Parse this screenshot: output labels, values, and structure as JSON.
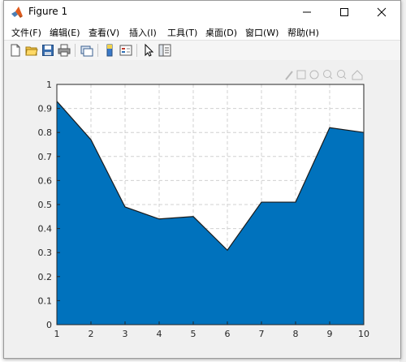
{
  "window": {
    "title": "Figure 1",
    "controls": {
      "minimize": "—",
      "maximize": "☐",
      "close": "✕"
    }
  },
  "menu": [
    {
      "label": "文件(F)"
    },
    {
      "label": "编辑(E)"
    },
    {
      "label": "查看(V)"
    },
    {
      "label": "插入(I)"
    },
    {
      "label": "工具(T)"
    },
    {
      "label": "桌面(D)"
    },
    {
      "label": "窗口(W)"
    },
    {
      "label": "帮助(H)"
    }
  ],
  "toolbar_icons": [
    "new-figure-icon",
    "open-file-icon",
    "save-icon",
    "print-icon",
    "link-plot-icon",
    "insert-colorbar-icon",
    "insert-legend-icon",
    "pointer-icon",
    "property-inspector-icon"
  ],
  "axes_toolbar_icons": [
    "brush-icon",
    "data-tips-icon",
    "rotate-icon",
    "zoom-in-icon",
    "zoom-out-icon",
    "home-icon"
  ],
  "colors": {
    "area_fill": "#0072bd",
    "edge": "#1a1a1a",
    "grid": "#d0d0d0"
  },
  "chart_data": {
    "type": "area",
    "x": [
      1,
      2,
      3,
      4,
      5,
      6,
      7,
      8,
      9,
      10
    ],
    "values": [
      0.93,
      0.77,
      0.49,
      0.44,
      0.45,
      0.31,
      0.51,
      0.51,
      0.82,
      0.8
    ],
    "xlim": [
      1,
      10
    ],
    "ylim": [
      0,
      1
    ],
    "xticks": [
      "1",
      "2",
      "3",
      "4",
      "5",
      "6",
      "7",
      "8",
      "9",
      "10"
    ],
    "yticks": [
      "0",
      "0.1",
      "0.2",
      "0.3",
      "0.4",
      "0.5",
      "0.6",
      "0.7",
      "0.8",
      "0.9",
      "1"
    ],
    "grid": true,
    "title": "",
    "xlabel": "",
    "ylabel": ""
  }
}
